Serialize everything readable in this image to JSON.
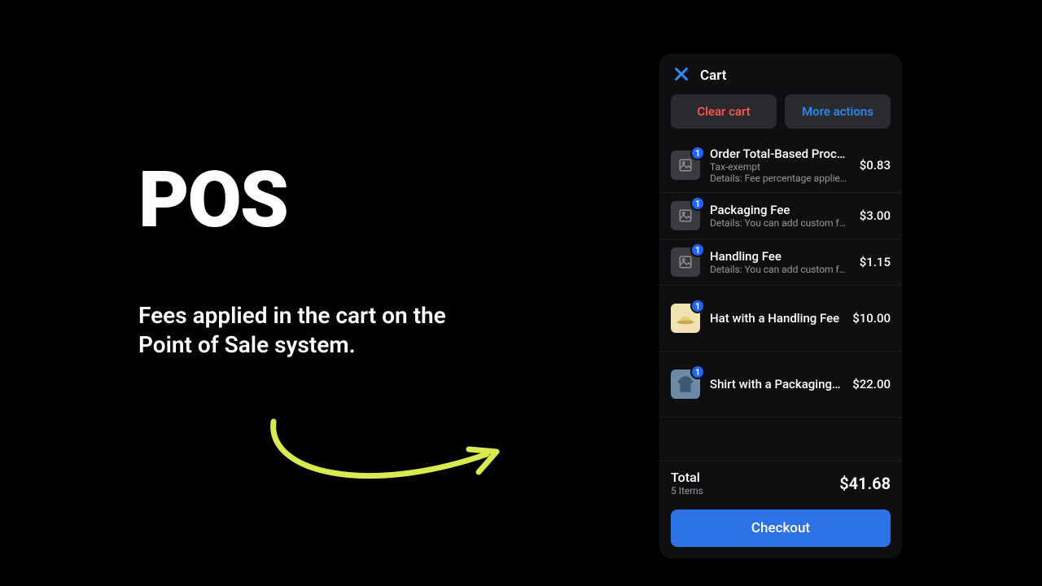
{
  "heading": "POS",
  "subtext": "Fees applied in the cart on the Point of Sale system.",
  "cart": {
    "title": "Cart",
    "clear_label": "Clear cart",
    "more_label": "More actions",
    "items": [
      {
        "title": "Order Total-Based Proces…",
        "sub1": "Tax-exempt",
        "sub2": "Details: Fee percentage applies…",
        "price": "$0.83",
        "qty": "1",
        "thumb": "placeholder"
      },
      {
        "title": "Packaging Fee",
        "sub1": "",
        "sub2": "Details: You can add custom fe…",
        "price": "$3.00",
        "qty": "1",
        "thumb": "placeholder"
      },
      {
        "title": "Handling Fee",
        "sub1": "",
        "sub2": "Details: You can add custom fee…",
        "price": "$1.15",
        "qty": "1",
        "thumb": "placeholder"
      },
      {
        "title": "Hat with a Handling Fee",
        "sub1": "",
        "sub2": "",
        "price": "$10.00",
        "qty": "1",
        "thumb": "hat"
      },
      {
        "title": "Shirt with a Packaging Fee",
        "sub1": "",
        "sub2": "",
        "price": "$22.00",
        "qty": "1",
        "thumb": "shirt"
      }
    ],
    "totals": {
      "label": "Total",
      "count_label": "5 Items",
      "amount": "$41.68"
    },
    "checkout_label": "Checkout"
  }
}
